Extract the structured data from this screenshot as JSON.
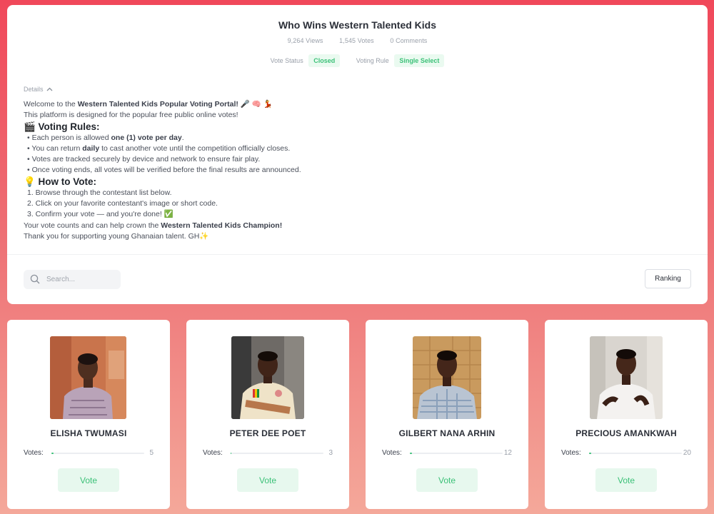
{
  "poll": {
    "title": "Who Wins Western Talented Kids",
    "views": "9,264 Views",
    "votes": "1,545 Votes",
    "comments": "0 Comments",
    "vote_status_label": "Vote Status",
    "vote_status_value": "Closed",
    "voting_rule_label": "Voting Rule",
    "voting_rule_value": "Single Select",
    "details_label": "Details"
  },
  "details": {
    "welcome_prefix": "Welcome to the ",
    "welcome_bold": "Western Talented Kids Popular Voting Portal!",
    "welcome_emoji": "🎤 🧠 💃",
    "intro": "This platform is designed for the popular free public online votes!",
    "rules_heading": "🎬  Voting Rules:",
    "rule1_a": "• Each person is allowed ",
    "rule1_b": "one (1) vote per day",
    "rule1_c": ".",
    "rule2_a": "• You can return ",
    "rule2_b": "daily",
    "rule2_c": " to cast another vote until the competition officially closes.",
    "rule3": "• Votes are tracked securely by device and network to ensure fair play.",
    "rule4": "• Once voting ends, all votes will be verified before the final results are announced.",
    "how_heading": "💡  How to Vote:",
    "step1": "1. Browse through the contestant list below.",
    "step2": "2. Click on your favorite contestant's image or short code.",
    "step3": "3. Confirm your vote — and you're done! ✅",
    "crown_a": "Your vote counts and can help crown the ",
    "crown_b": "Western Talented Kids Champion!",
    "thanks": "Thank you for supporting young Ghanaian talent. GH✨"
  },
  "search": {
    "placeholder": "Search..."
  },
  "ranking_label": "Ranking",
  "votes_label": "Votes:",
  "vote_button": "Vote",
  "contestants": [
    {
      "name": "ELISHA TWUMASI",
      "votes": "5",
      "fraction": 0.02
    },
    {
      "name": "PETER DEE POET",
      "votes": "3",
      "fraction": 0.01
    },
    {
      "name": "GILBERT NANA ARHIN",
      "votes": "12",
      "fraction": 0.02
    },
    {
      "name": "PRECIOUS AMANKWAH",
      "votes": "20",
      "fraction": 0.02
    }
  ],
  "colors": {
    "accent": "#3cc178",
    "tag_bg": "#eafaf0",
    "page_top": "#f0485a",
    "page_bottom": "#f4a89a"
  }
}
